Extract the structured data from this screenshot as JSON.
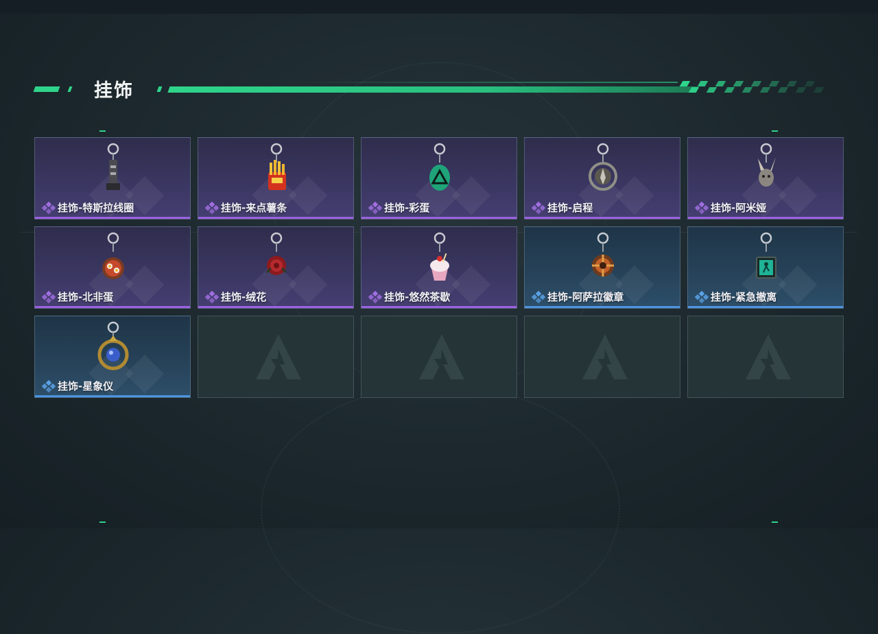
{
  "header": {
    "title": "挂饰"
  },
  "colors": {
    "accent": "#2fd48b",
    "purple_rarity": "#9a62df",
    "blue_rarity": "#4d94e0"
  },
  "items": [
    {
      "label": "挂饰-特斯拉线圈",
      "rarity": "purple",
      "icon": "tesla-coil-charm-icon"
    },
    {
      "label": "挂饰-来点薯条",
      "rarity": "purple",
      "icon": "french-fries-charm-icon"
    },
    {
      "label": "挂饰-彩蛋",
      "rarity": "purple",
      "icon": "easter-egg-charm-icon"
    },
    {
      "label": "挂饰-启程",
      "rarity": "purple",
      "icon": "compass-medallion-charm-icon"
    },
    {
      "label": "挂饰-阿米娅",
      "rarity": "purple",
      "icon": "bunny-charm-icon"
    },
    {
      "label": "挂饰-北非蛋",
      "rarity": "purple",
      "icon": "shakshuka-charm-icon"
    },
    {
      "label": "挂饰-绒花",
      "rarity": "purple",
      "icon": "velvet-flower-charm-icon"
    },
    {
      "label": "挂饰-悠然茶歇",
      "rarity": "purple",
      "icon": "cupcake-charm-icon"
    },
    {
      "label": "挂饰-阿萨拉徽章",
      "rarity": "blue",
      "icon": "asala-badge-charm-icon"
    },
    {
      "label": "挂饰-紧急撤离",
      "rarity": "blue",
      "icon": "emergency-exit-charm-icon"
    },
    {
      "label": "挂饰-星象仪",
      "rarity": "blue",
      "icon": "astrolabe-charm-icon"
    }
  ],
  "empty_slots": 4
}
